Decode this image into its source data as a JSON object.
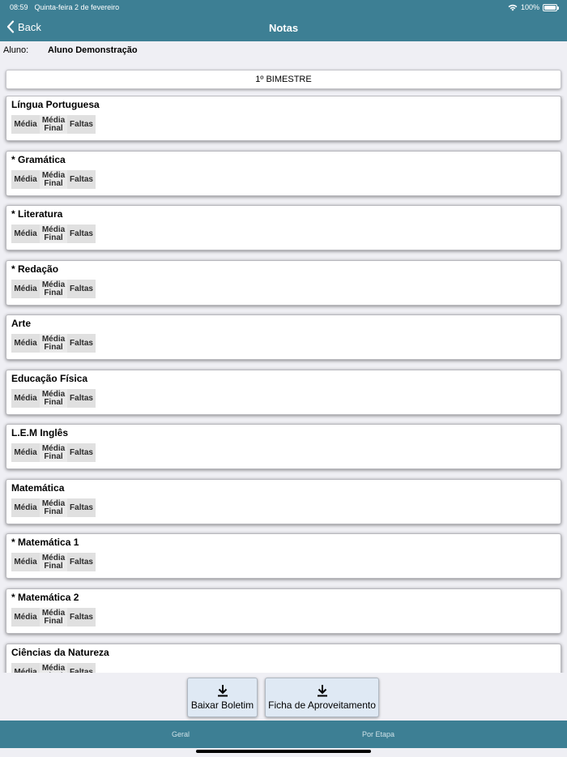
{
  "statusbar": {
    "time": "08:59",
    "date": "Quinta-feira 2 de fevereiro",
    "battery": "100%"
  },
  "nav": {
    "back_label": "Back",
    "title": "Notas"
  },
  "student": {
    "label": "Aluno:",
    "name": "Aluno Demonstração"
  },
  "period": "1º BIMESTRE",
  "columns": {
    "media": "Média",
    "media_final_1": "Média",
    "media_final_2": "Final",
    "faltas": "Faltas"
  },
  "subjects": [
    {
      "name": "Língua Portuguesa"
    },
    {
      "name": "* Gramática"
    },
    {
      "name": "* Literatura"
    },
    {
      "name": "* Redação"
    },
    {
      "name": "Arte"
    },
    {
      "name": "Educação Física"
    },
    {
      "name": "L.E.M Inglês"
    },
    {
      "name": "Matemática"
    },
    {
      "name": "* Matemática 1"
    },
    {
      "name": "* Matemática 2"
    },
    {
      "name": "Ciências da Natureza"
    }
  ],
  "actions": {
    "download_report": "Baixar Boletim",
    "performance_sheet": "Ficha de Aproveitamento"
  },
  "tabs": [
    {
      "label": "Geral"
    },
    {
      "label": "Por Etapa"
    }
  ],
  "colors": {
    "header": "#3d7f94",
    "background": "#efeff4",
    "button": "#dfe9f4",
    "grade_cell": "#e0e0e0"
  },
  "icons": {
    "back": "chevron-left-icon",
    "download": "download-icon",
    "wifi": "wifi-icon",
    "battery": "battery-icon"
  }
}
